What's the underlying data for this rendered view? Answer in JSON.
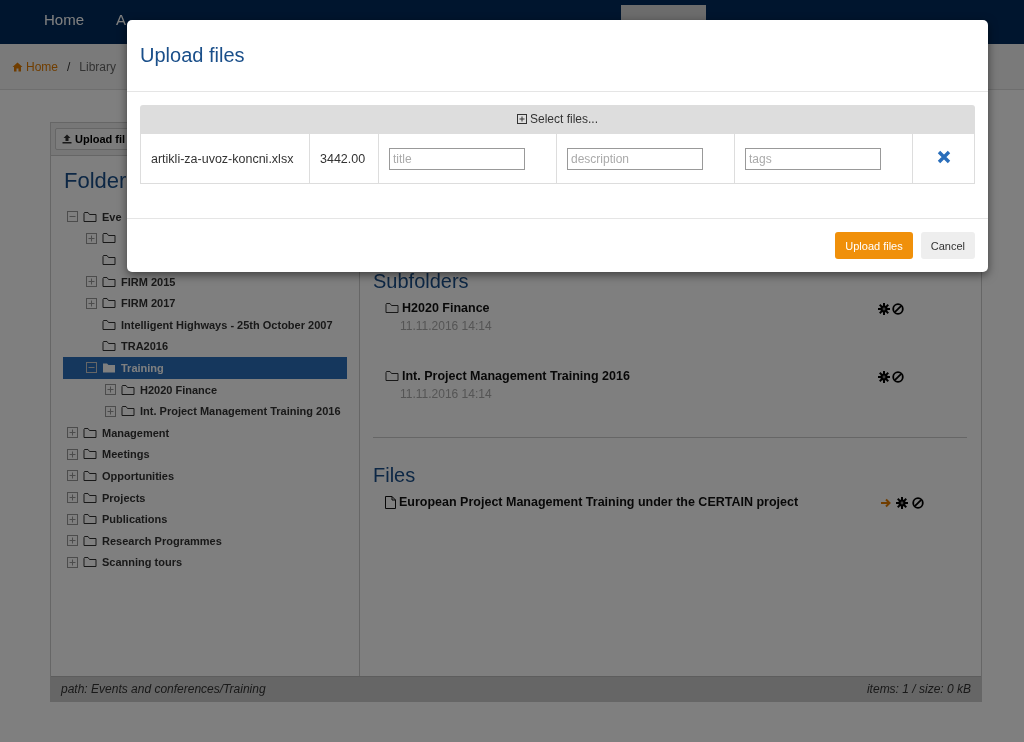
{
  "nav": {
    "items": [
      {
        "label": "Home",
        "selected": false
      },
      {
        "label": "A",
        "selected": false
      },
      {
        "selected": true
      }
    ]
  },
  "breadcrumb": {
    "items": [
      "Home",
      "Library"
    ],
    "separator": "/"
  },
  "toolbar": {
    "upload_button": "Upload fil"
  },
  "tree": {
    "title": "Folder",
    "items": [
      {
        "label": "Eve",
        "expanded": true,
        "selected": false,
        "children": [
          {
            "expanded": false,
            "selected": false
          },
          {
            "selected": false
          },
          {
            "label": "FIRM 2015",
            "expanded": false,
            "selected": false
          },
          {
            "label": "FIRM 2017",
            "expanded": false,
            "selected": false
          },
          {
            "label": "Intelligent Highways - 25th October 2007",
            "selected": false
          },
          {
            "label": "TRA2016",
            "selected": false
          },
          {
            "label": "Training",
            "expanded": true,
            "selected": true,
            "children": [
              {
                "label": "H2020 Finance",
                "expanded": false,
                "selected": false
              },
              {
                "label": "Int. Project Management Training 2016",
                "expanded": false,
                "selected": false
              }
            ]
          }
        ]
      },
      {
        "label": "Management",
        "expanded": false,
        "selected": false
      },
      {
        "label": "Meetings",
        "expanded": false,
        "selected": false
      },
      {
        "label": "Opportunities",
        "expanded": false,
        "selected": false
      },
      {
        "label": "Projects",
        "expanded": false,
        "selected": false
      },
      {
        "label": "Publications",
        "expanded": false,
        "selected": false
      },
      {
        "label": "Research Programmes",
        "expanded": false,
        "selected": false
      },
      {
        "label": "Scanning tours",
        "expanded": false,
        "selected": false
      }
    ]
  },
  "subfolders": {
    "title": "Subfolders",
    "items": [
      {
        "name": "H2020 Finance",
        "date": "11.11.2016 14:14"
      },
      {
        "name": "Int. Project Management Training 2016",
        "date": "11.11.2016 14:14"
      }
    ]
  },
  "files": {
    "title": "Files",
    "items": [
      {
        "name": "European Project Management Training under the CERTAIN project"
      }
    ]
  },
  "status_bar": {
    "path": "path: Events and conferences/Training",
    "summary": "items: 1 / size: 0 kB"
  },
  "modal": {
    "title": "Upload files",
    "select_button": "Select files...",
    "rows": [
      {
        "filename": "artikli-za-uvoz-koncni.xlsx",
        "size": "3442.00",
        "fields": [
          {
            "placeholder": "title"
          },
          {
            "placeholder": "description"
          },
          {
            "placeholder": "tags"
          }
        ]
      }
    ],
    "buttons": [
      {
        "label": "Upload files",
        "kind": "primary"
      },
      {
        "label": "Cancel",
        "kind": "default"
      }
    ]
  }
}
